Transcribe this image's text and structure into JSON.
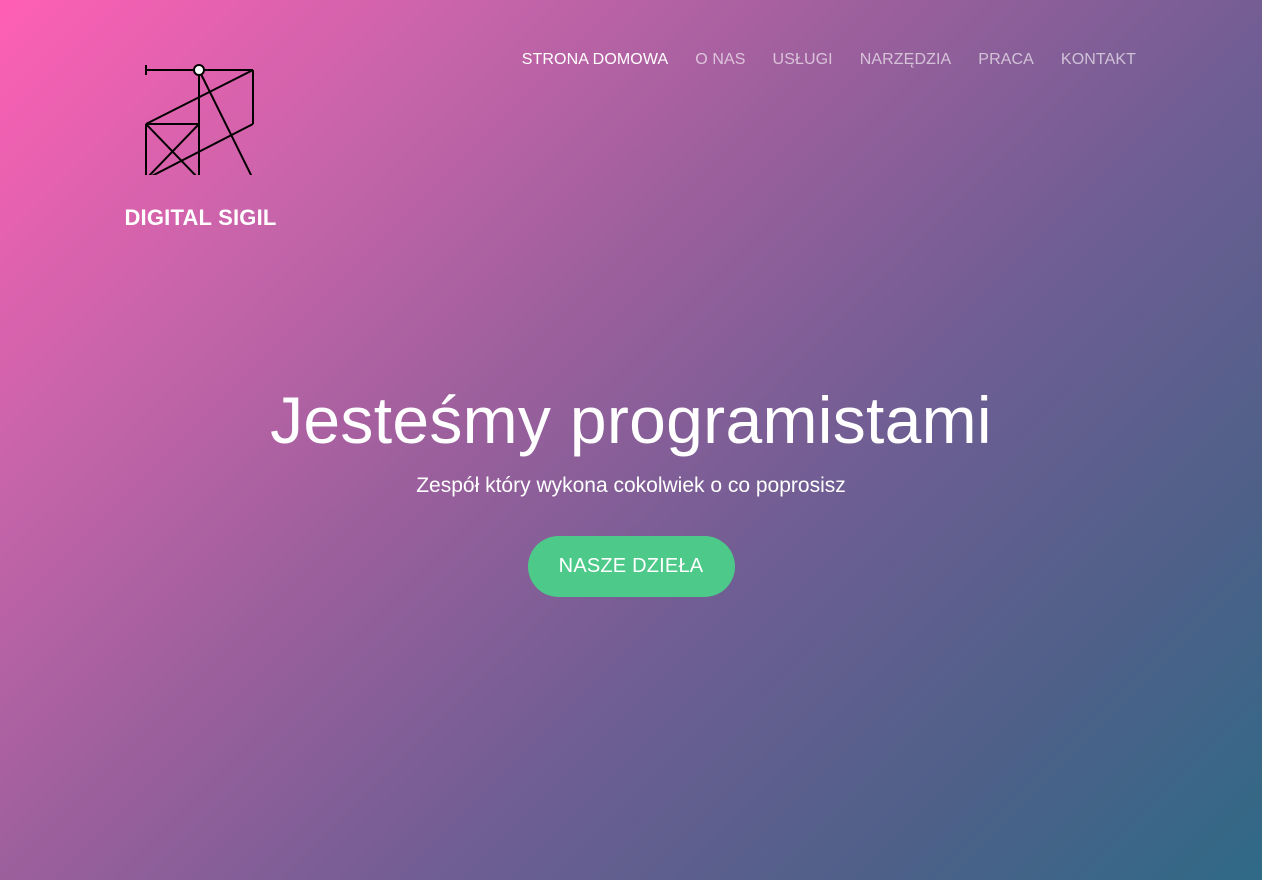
{
  "brand": {
    "name": "DIGITAL SIGIL",
    "logo_icon": "geometric-sigil-icon"
  },
  "nav": {
    "items": [
      {
        "label": "STRONA DOMOWA",
        "active": true
      },
      {
        "label": "O NAS",
        "active": false
      },
      {
        "label": "USŁUGI",
        "active": false
      },
      {
        "label": "NARZĘDZIA",
        "active": false
      },
      {
        "label": "PRACA",
        "active": false
      },
      {
        "label": "KONTAKT",
        "active": false
      }
    ]
  },
  "hero": {
    "title": "Jesteśmy programistami",
    "subtitle": "Zespół który wykona cokolwiek o co poprosisz",
    "cta_label": "NASZE DZIEŁA"
  },
  "colors": {
    "gradient_start": "#ff5fb4",
    "gradient_end": "#2f6a86",
    "cta_background": "#4dc98a",
    "text": "#ffffff"
  }
}
